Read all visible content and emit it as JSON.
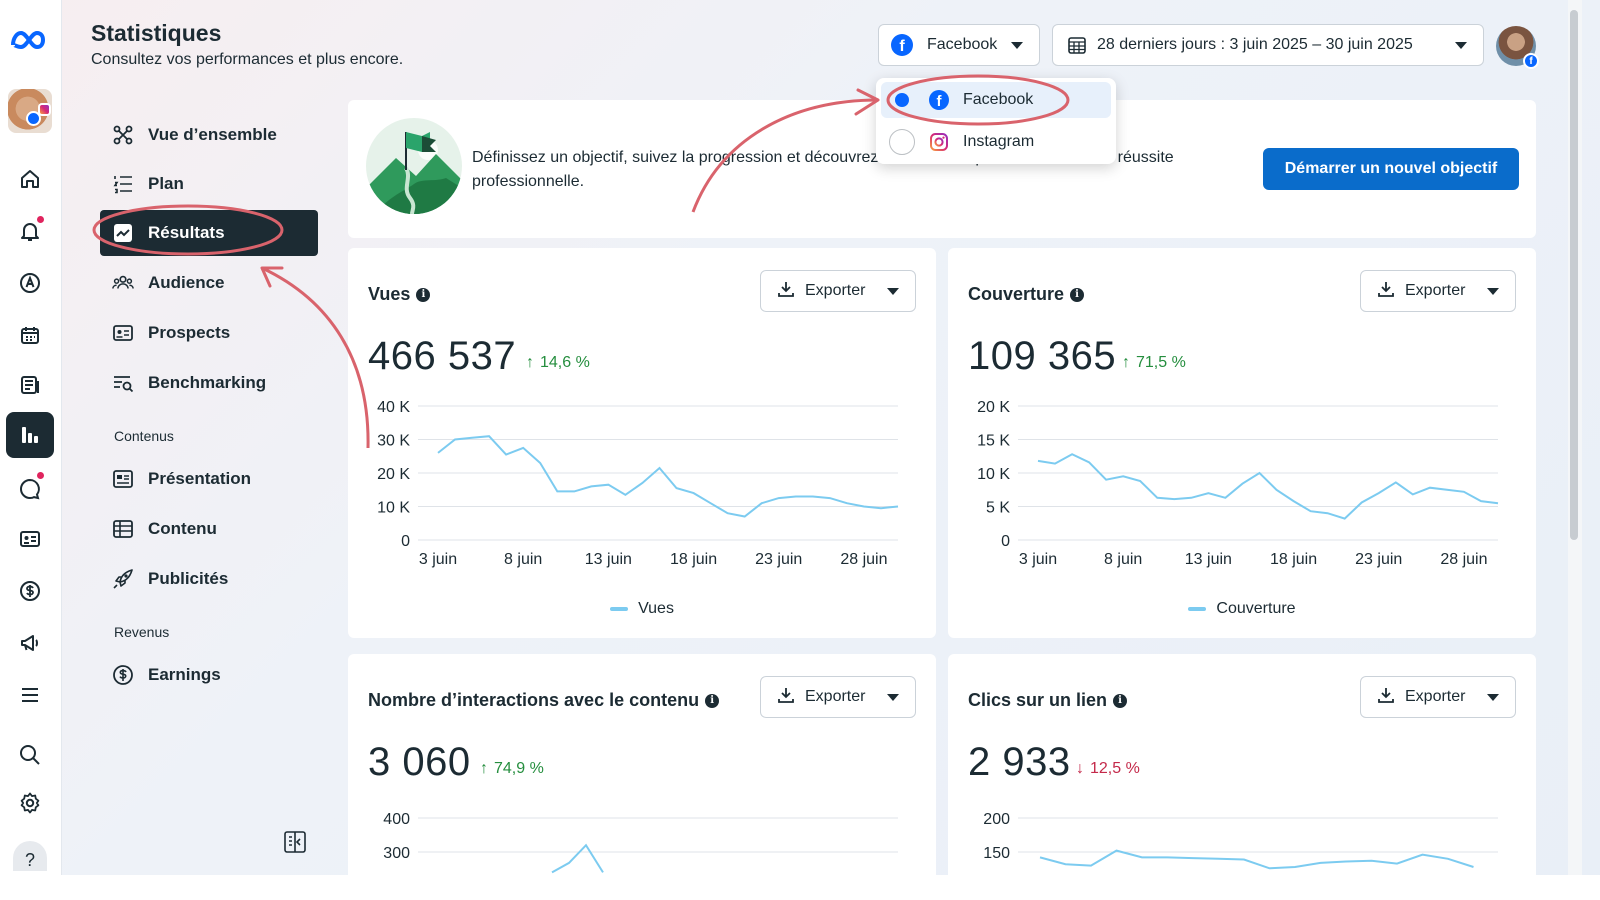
{
  "header": {
    "title": "Statistiques",
    "subtitle": "Consultez vos performances et plus encore."
  },
  "platform_selector": {
    "label": "Facebook"
  },
  "date_selector": {
    "label": "28 derniers jours : 3 juin 2025 – 30 juin 2025"
  },
  "platform_dropdown": {
    "options": [
      {
        "label": "Facebook",
        "selected": true
      },
      {
        "label": "Instagram",
        "selected": false
      }
    ]
  },
  "sidebar": {
    "items": [
      {
        "label": "Vue d’ensemble",
        "icon": "overview-icon"
      },
      {
        "label": "Plan",
        "icon": "plan-list-icon"
      },
      {
        "label": "Résultats",
        "icon": "results-chart-icon",
        "active": true
      },
      {
        "label": "Audience",
        "icon": "audience-icon"
      },
      {
        "label": "Prospects",
        "icon": "prospects-icon"
      },
      {
        "label": "Benchmarking",
        "icon": "benchmarking-icon"
      }
    ],
    "section_contenus": "Contenus",
    "contenus_items": [
      {
        "label": "Présentation",
        "icon": "presentation-icon"
      },
      {
        "label": "Contenu",
        "icon": "content-table-icon"
      },
      {
        "label": "Publicités",
        "icon": "ads-rocket-icon"
      }
    ],
    "section_revenus": "Revenus",
    "revenus_items": [
      {
        "label": "Earnings",
        "icon": "earnings-dollar-icon"
      }
    ]
  },
  "goal_card": {
    "text_line1": "Définissez un objectif, suivez la progression et découvrez des conseils pour favoriser votre réussite",
    "text_line2": "professionnelle.",
    "button": "Démarrer un nouvel objectif"
  },
  "export_label": "Exporter",
  "colors": {
    "accent": "#0a6ccb",
    "line": "#7ccbf0",
    "annotation": "#d9636c",
    "nav_active": "#1c2b33"
  },
  "metrics": [
    {
      "title": "Vues",
      "value": "466 537",
      "delta": "14,6 %",
      "direction": "up",
      "legend": "Vues"
    },
    {
      "title": "Couverture",
      "value": "109 365",
      "delta": "71,5 %",
      "direction": "up",
      "legend": "Couverture"
    },
    {
      "title": "Nombre d’interactions avec le contenu",
      "value": "3 060",
      "delta": "74,9 %",
      "direction": "up",
      "legend": ""
    },
    {
      "title": "Clics sur un lien",
      "value": "2 933",
      "delta": "12,5 %",
      "direction": "down",
      "legend": ""
    }
  ],
  "chart_data": [
    {
      "type": "line",
      "title": "Vues",
      "x_tick_labels": [
        "3 juin",
        "8 juin",
        "13 juin",
        "18 juin",
        "23 juin",
        "28 juin"
      ],
      "y_tick_labels": [
        "0",
        "10 K",
        "20 K",
        "30 K",
        "40 K"
      ],
      "ylim": [
        0,
        40000
      ],
      "grid": true,
      "legend": "bottom-center",
      "series": [
        {
          "name": "Vues",
          "values": [
            26000,
            30000,
            30500,
            31000,
            25500,
            27500,
            23000,
            14500,
            14500,
            16000,
            16500,
            13500,
            17000,
            21500,
            15500,
            14000,
            11000,
            8000,
            7000,
            11000,
            12500,
            13000,
            13000,
            12500,
            11000,
            10000,
            9500,
            10000
          ]
        }
      ]
    },
    {
      "type": "line",
      "title": "Couverture",
      "x_tick_labels": [
        "3 juin",
        "8 juin",
        "13 juin",
        "18 juin",
        "23 juin",
        "28 juin"
      ],
      "y_tick_labels": [
        "0",
        "5 K",
        "10 K",
        "15 K",
        "20 K"
      ],
      "ylim": [
        0,
        20000
      ],
      "grid": true,
      "legend": "bottom-center",
      "series": [
        {
          "name": "Couverture",
          "values": [
            11800,
            11400,
            12800,
            11600,
            9000,
            9500,
            8800,
            6300,
            6100,
            6300,
            7000,
            6300,
            8400,
            10000,
            7500,
            5800,
            4300,
            4000,
            3200,
            5600,
            7000,
            8600,
            6800,
            7800,
            7500,
            7200,
            5800,
            5500
          ]
        }
      ]
    },
    {
      "type": "line",
      "title": "Nombre d’interactions avec le contenu",
      "x_tick_labels": [],
      "y_tick_labels": [
        "300",
        "400"
      ],
      "visible_y_range": [
        270,
        400
      ],
      "grid": true,
      "series": [
        {
          "values": [
            null,
            null,
            null,
            null,
            null,
            null,
            null,
            null,
            240,
            268,
            320,
            240
          ]
        }
      ]
    },
    {
      "type": "line",
      "title": "Clics sur un lien",
      "x_tick_labels": [],
      "y_tick_labels": [
        "150",
        "200"
      ],
      "visible_y_range": [
        130,
        200
      ],
      "grid": true,
      "series": [
        {
          "values": [
            142,
            132,
            130,
            152,
            142,
            142,
            141,
            140,
            139,
            126,
            128,
            134,
            136,
            137,
            133,
            146,
            140,
            128
          ]
        }
      ]
    }
  ]
}
